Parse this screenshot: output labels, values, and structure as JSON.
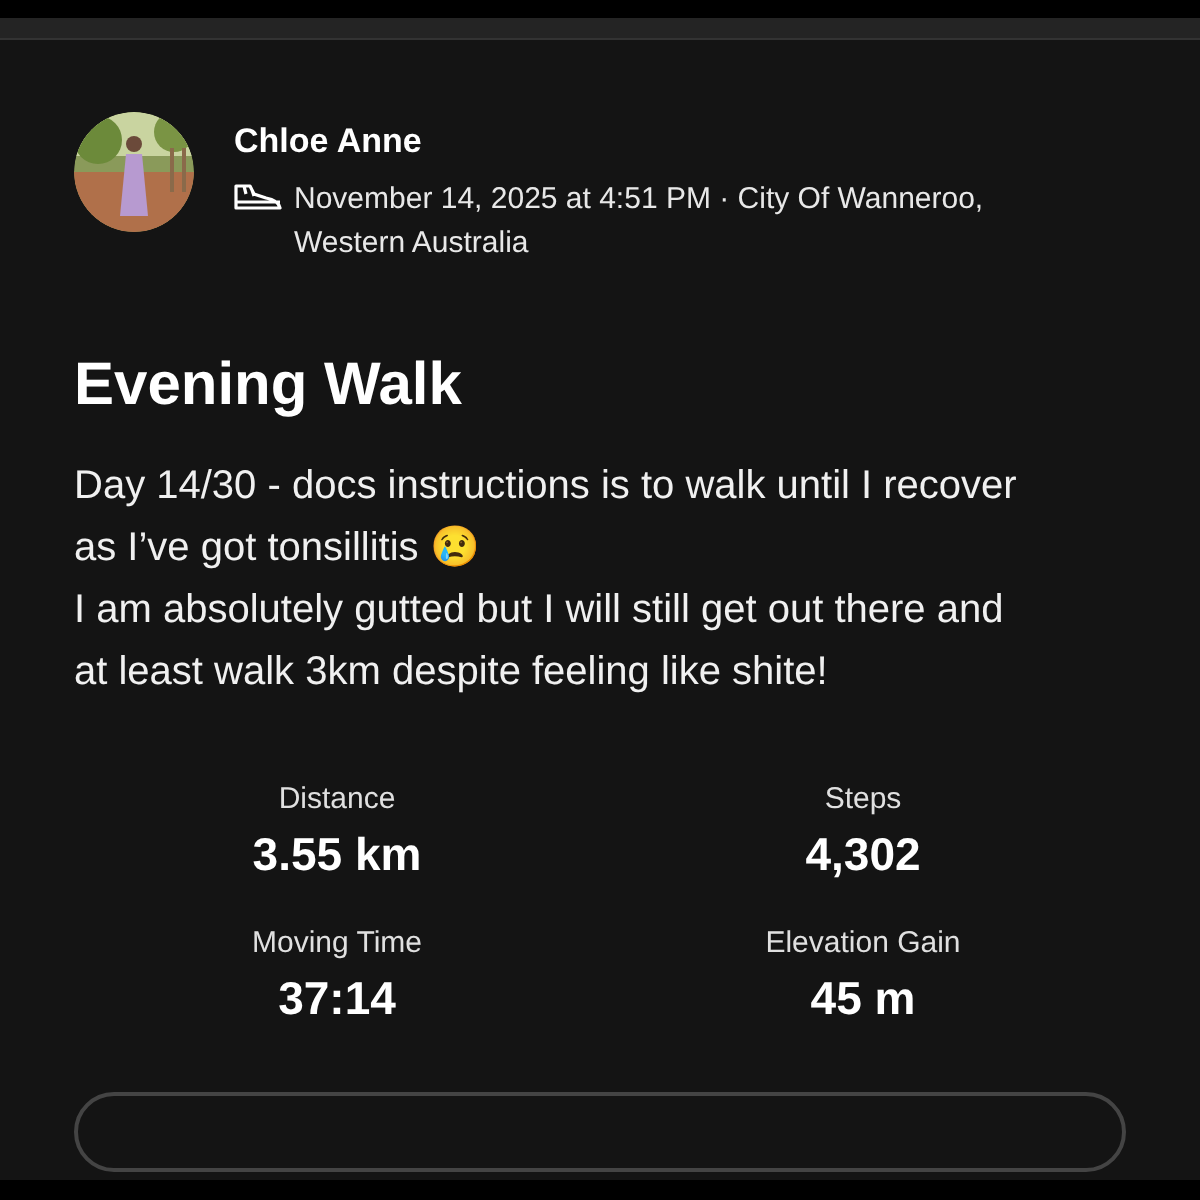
{
  "athlete": {
    "name": "Chloe Anne",
    "meta": "November 14, 2025 at 4:51 PM · City Of Wanneroo, Western Australia"
  },
  "activity": {
    "title": "Evening Walk",
    "description": [
      "Day 14/30 - docs instructions is to walk until I recover as I’ve got tonsillitis 😢",
      "I am absolutely gutted but I will still get out there and at least walk 3km despite feeling like shite!"
    ]
  },
  "stats": [
    {
      "label": "Distance",
      "value": "3.55 km"
    },
    {
      "label": "Steps",
      "value": "4,302"
    },
    {
      "label": "Moving Time",
      "value": "37:14"
    },
    {
      "label": "Elevation Gain",
      "value": "45 m"
    }
  ]
}
